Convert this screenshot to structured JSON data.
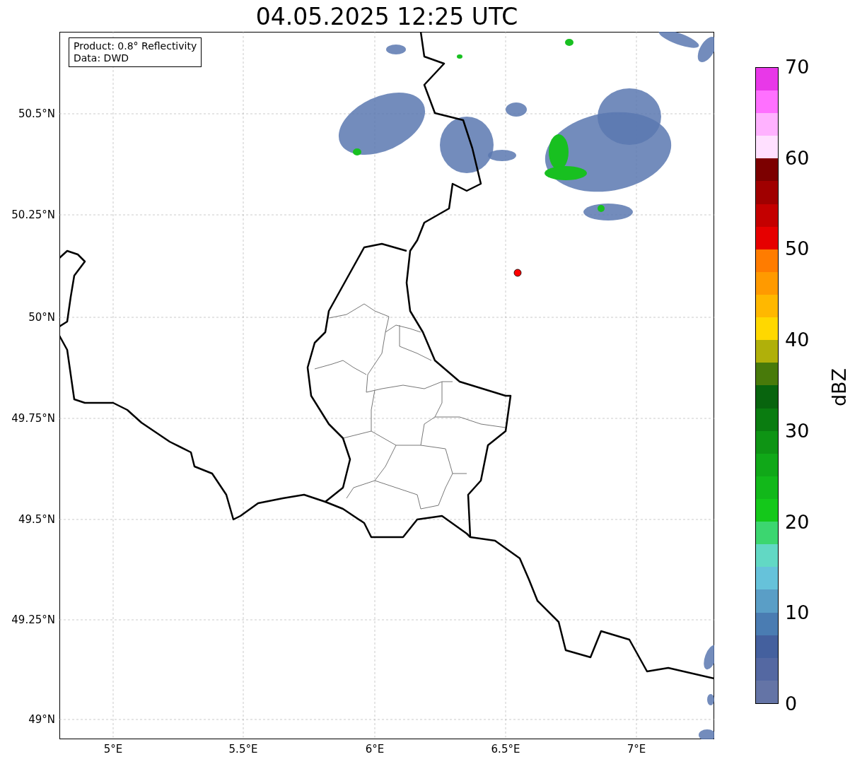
{
  "title": "04.05.2025 12:25 UTC",
  "info_box": [
    "Product: 0.8° Reflectivity",
    "Data: DWD"
  ],
  "map": {
    "lat_ticks": [
      "50.5°N",
      "50.25°N",
      "50°N",
      "49.75°N",
      "49.5°N",
      "49.25°N",
      "49°N"
    ],
    "lon_ticks": [
      "5°E",
      "5.5°E",
      "6°E",
      "6.5°E",
      "7°E"
    ]
  },
  "colorbar": {
    "label": "dBZ",
    "ticks": [
      "70",
      "60",
      "50",
      "40",
      "30",
      "20",
      "10",
      "0"
    ],
    "bins": [
      {
        "color": "#6474a6"
      },
      {
        "color": "#5468a2"
      },
      {
        "color": "#44609e"
      },
      {
        "color": "#4a7cb2"
      },
      {
        "color": "#5a9ec6"
      },
      {
        "color": "#66c2da"
      },
      {
        "color": "#62d8c4"
      },
      {
        "color": "#3cd670"
      },
      {
        "color": "#14c81a"
      },
      {
        "color": "#12b81a"
      },
      {
        "color": "#10a818"
      },
      {
        "color": "#0e9414"
      },
      {
        "color": "#0a7c10"
      },
      {
        "color": "#08640e"
      },
      {
        "color": "#487a0a"
      },
      {
        "color": "#b0b00a"
      },
      {
        "color": "#ffd800"
      },
      {
        "color": "#ffb800"
      },
      {
        "color": "#ff9a00"
      },
      {
        "color": "#ff7c00"
      },
      {
        "color": "#e60000"
      },
      {
        "color": "#c40000"
      },
      {
        "color": "#a00000"
      },
      {
        "color": "#7c0000"
      },
      {
        "color": "#ffe0ff"
      },
      {
        "color": "#ffb2ff"
      },
      {
        "color": "#ff70ff"
      },
      {
        "color": "#e838e8"
      }
    ]
  }
}
